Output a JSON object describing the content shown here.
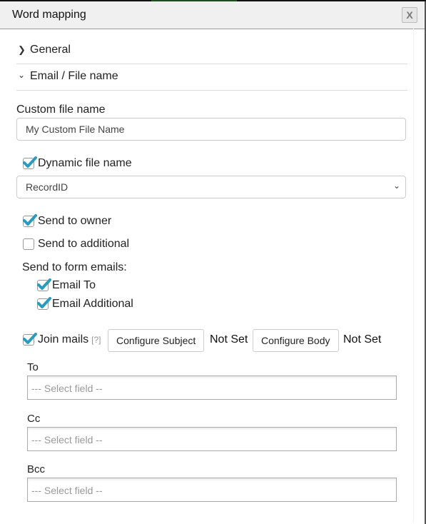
{
  "dialog": {
    "title": "Word mapping",
    "close_label": "X"
  },
  "sections": {
    "general": {
      "label": "General",
      "expanded": false
    },
    "email_file": {
      "label": "Email / File name",
      "expanded": true
    }
  },
  "custom_file_name": {
    "label": "Custom file name",
    "value": "My Custom File Name"
  },
  "dynamic_file_name": {
    "label": "Dynamic file name",
    "checked": true,
    "selected_option": "RecordID"
  },
  "send_to_owner": {
    "label": "Send to owner",
    "checked": true
  },
  "send_to_additional": {
    "label": "Send to additional",
    "checked": false
  },
  "form_emails": {
    "label": "Send to form emails:",
    "email_to": {
      "label": "Email To",
      "checked": true
    },
    "email_additional": {
      "label": "Email Additional",
      "checked": true
    }
  },
  "join_mails": {
    "label": "Join mails",
    "help": "[?]",
    "checked": true,
    "configure_subject_label": "Configure Subject",
    "subject_status": "Not Set",
    "configure_body_label": "Configure Body",
    "body_status": "Not Set"
  },
  "recipients": {
    "to": {
      "label": "To",
      "placeholder": "--- Select field --"
    },
    "cc": {
      "label": "Cc",
      "placeholder": "--- Select field --"
    },
    "bcc": {
      "label": "Bcc",
      "placeholder": "--- Select field --"
    }
  },
  "colors": {
    "check": "#2a9bc0",
    "title_bar": "#f0f0f0"
  }
}
